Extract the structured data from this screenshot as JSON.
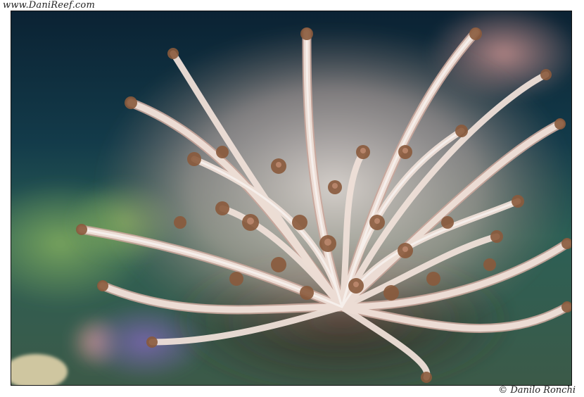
{
  "watermark": {
    "site": "www.DaniReef.com"
  },
  "credit": {
    "text": "© Danilo Ronchi"
  },
  "photo": {
    "subject": "coral-polyps",
    "colors": {
      "water_dark": "#0b2233",
      "water_teal": "#184a55",
      "algae_green": "#6e9a55",
      "stalk_light": "#f1e3dc",
      "stalk_pink": "#d9b7ad",
      "polyp_brown": "#8a5a3c",
      "rock_purple": "#6c5a9a"
    }
  }
}
